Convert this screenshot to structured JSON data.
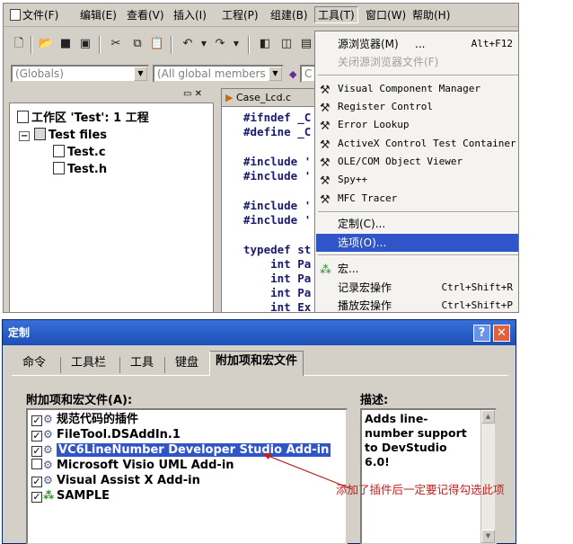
{
  "menubar": {
    "items": [
      {
        "label": "文件(F)"
      },
      {
        "label": "编辑(E)"
      },
      {
        "label": "查看(V)"
      },
      {
        "label": "插入(I)"
      },
      {
        "label": "工程(P)"
      },
      {
        "label": "组建(B)"
      },
      {
        "label": "工具(T)"
      },
      {
        "label": "窗口(W)"
      },
      {
        "label": "帮助(H)"
      }
    ]
  },
  "combos": {
    "globals": "(Globals)",
    "members": "(All global members",
    "third": "C"
  },
  "workspace": {
    "root": "工作区 'Test': 1 工程",
    "folder": "Test files",
    "files": [
      "Test.c",
      "Test.h"
    ]
  },
  "editor": {
    "tab_label": "Case_Lcd.c",
    "lines": [
      "#ifndef _C",
      "#define _C",
      "#include '",
      "#include '",
      "#include '",
      "#include '",
      "typedef st",
      "    int Pa",
      "    int Pa",
      "    int Pa",
      "    int Ex"
    ]
  },
  "tools_menu": {
    "source_browser": "源浏览器(M)",
    "source_browser_dots": "...",
    "source_browser_key": "Alt+F12",
    "close_browser": "关闭源浏览器文件(F)",
    "tools": [
      "Visual Component Manager",
      "Register Control",
      "Error Lookup",
      "ActiveX Control Test Container",
      "OLE/COM Object Viewer",
      "Spy++",
      "MFC Tracer"
    ],
    "customize": "定制(C)...",
    "options": "选项(O)...",
    "macro": "宏...",
    "record_macro": "记录宏操作",
    "record_macro_key": "Ctrl+Shift+R",
    "play_macro": "播放宏操作",
    "play_macro_key": "Ctrl+Shift+P"
  },
  "dialog": {
    "title": "定制",
    "help_glyph": "?",
    "close_glyph": "✕",
    "tabs": [
      "命令",
      "工具栏",
      "工具",
      "键盘",
      "附加项和宏文件"
    ],
    "list_label": "附加项和宏文件(A):",
    "desc_label": "描述:",
    "addins": [
      {
        "name": "规范代码的插件",
        "checked": true
      },
      {
        "name": "FileTool.DSAddIn.1",
        "checked": true
      },
      {
        "name": "VC6LineNumber Developer Studio Add-in",
        "checked": true
      },
      {
        "name": "Microsoft Visio UML Add-in",
        "checked": false
      },
      {
        "name": "Visual Assist X Add-in",
        "checked": true
      },
      {
        "name": "SAMPLE",
        "checked": true
      }
    ],
    "description": "Adds line-number support to DevStudio 6.0!"
  },
  "annotation": {
    "text": "添加了插件后一定要记得勾选此项",
    "color": "#c02020"
  },
  "colors": {
    "selection": "#2f55c8",
    "title_bar": "#1c4fb8",
    "face": "#d4d0c8"
  }
}
